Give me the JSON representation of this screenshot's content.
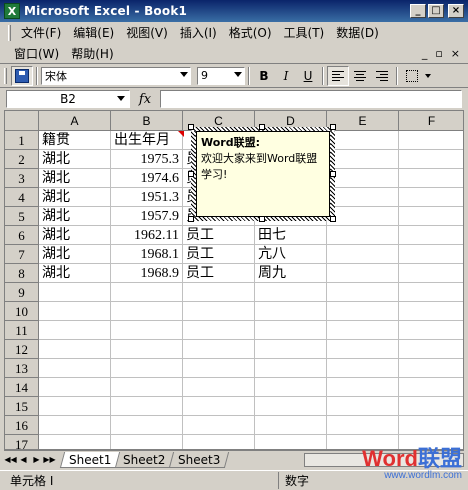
{
  "window": {
    "title": "Microsoft Excel - Book1",
    "app_icon": "excel-icon",
    "controls": [
      "_",
      "□",
      "×"
    ]
  },
  "menu": {
    "row1": [
      {
        "label": "文件(F)"
      },
      {
        "label": "编辑(E)"
      },
      {
        "label": "视图(V)"
      },
      {
        "label": "插入(I)"
      },
      {
        "label": "格式(O)"
      },
      {
        "label": "工具(T)"
      },
      {
        "label": "数据(D)"
      }
    ],
    "row2": [
      {
        "label": "窗口(W)"
      },
      {
        "label": "帮助(H)"
      }
    ],
    "doc_controls": [
      "_",
      "▫",
      "×"
    ]
  },
  "toolbar": {
    "font_name": "宋体",
    "font_size": "9",
    "bold": "B",
    "italic": "I",
    "underline": "U"
  },
  "formula_bar": {
    "name_box": "B2",
    "fx": "fx",
    "formula": ""
  },
  "grid": {
    "columns": [
      "A",
      "B",
      "C",
      "D",
      "E",
      "F"
    ],
    "rows": [
      "1",
      "2",
      "3",
      "4",
      "5",
      "6",
      "7",
      "8",
      "9",
      "10",
      "11",
      "12",
      "13",
      "14",
      "15",
      "16",
      "17"
    ],
    "cells": [
      [
        "籍贯",
        "出生年月",
        "",
        "",
        "",
        ""
      ],
      [
        "湖北",
        "1975.3",
        "员",
        "",
        "",
        ""
      ],
      [
        "湖北",
        "1974.6",
        "员",
        "",
        "",
        ""
      ],
      [
        "湖北",
        "1951.3",
        "员",
        "",
        "",
        ""
      ],
      [
        "湖北",
        "1957.9",
        "员",
        "",
        "",
        ""
      ],
      [
        "湖北",
        "1962.11",
        "员工",
        "田七",
        "",
        ""
      ],
      [
        "湖北",
        "1968.1",
        "员工",
        "亢八",
        "",
        ""
      ],
      [
        "湖北",
        "1968.9",
        "员工",
        "周九",
        "",
        ""
      ]
    ]
  },
  "comment": {
    "author": "Word联盟:",
    "text": "欢迎大家来到Word联盟学习!"
  },
  "sheets": {
    "tabs": [
      "Sheet1",
      "Sheet2",
      "Sheet3"
    ],
    "active": "Sheet1",
    "nav": [
      "◀◀",
      "◀",
      "▶",
      "▶▶"
    ]
  },
  "status": {
    "left": "单元格 I",
    "mode": "数字"
  },
  "watermark": {
    "logo_part1": "Word",
    "logo_part2": "联盟",
    "url": "www.wordlm.com"
  }
}
